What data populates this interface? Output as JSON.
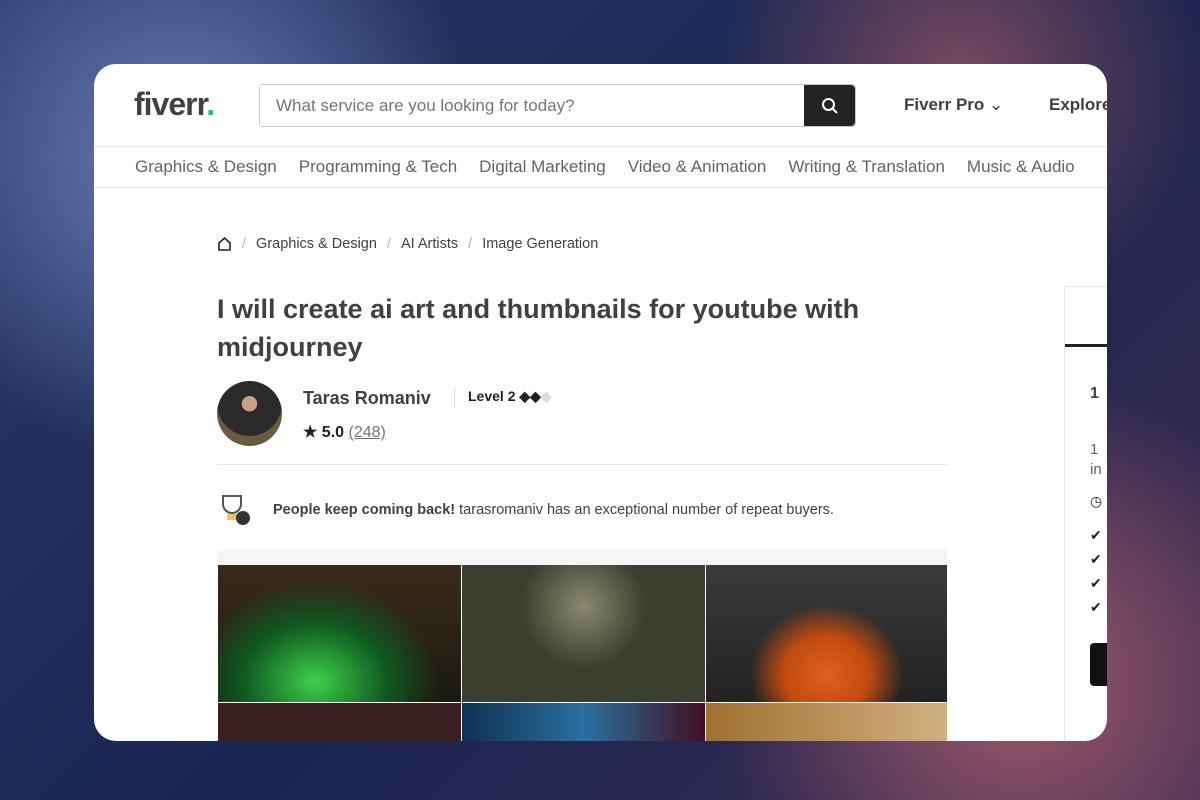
{
  "header": {
    "logo": "fiverr",
    "logo_dot": ".",
    "search_placeholder": "What service are you looking for today?",
    "pro": "Fiverr Pro",
    "explore": "Explore"
  },
  "categories": [
    "Graphics & Design",
    "Programming & Tech",
    "Digital Marketing",
    "Video & Animation",
    "Writing & Translation",
    "Music & Audio"
  ],
  "breadcrumb": [
    "Graphics & Design",
    "AI Artists",
    "Image Generation"
  ],
  "gig": {
    "title": "I will create ai art and thumbnails for youtube with midjourney",
    "seller": "Taras Romaniv",
    "level": "Level 2",
    "rating": "5.0",
    "reviews": "(248)"
  },
  "repeat": {
    "bold": "People keep coming back!",
    "text": "tarasromaniv has an exceptional number of repeat buyers."
  },
  "sidebar": {
    "price": "1",
    "desc1": "1",
    "desc2": "in"
  }
}
